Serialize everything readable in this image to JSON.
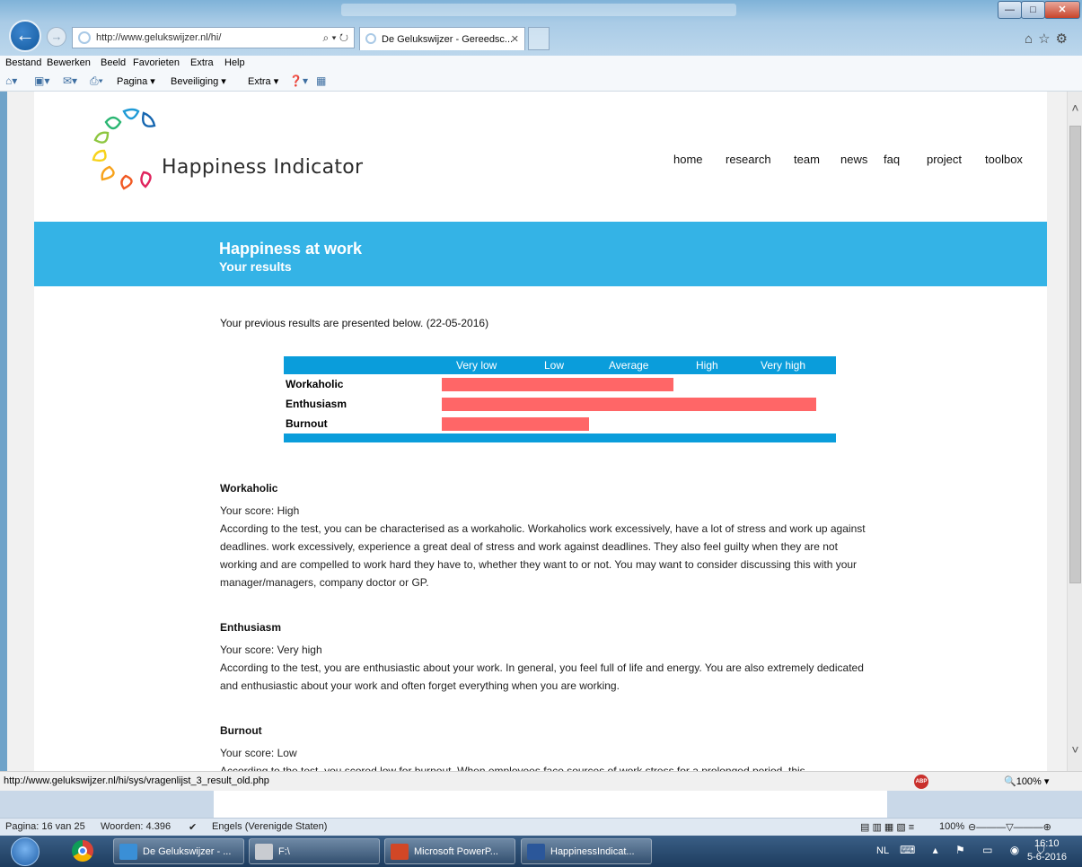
{
  "browser": {
    "url": "http://www.gelukswijzer.nl/hi/",
    "addr_actions": "⌕ ▾ ↻",
    "tab_title": "De Gelukswijzer - Gereedsc...",
    "tab_close": "✕",
    "window_buttons": {
      "minimize": "—",
      "maximize": "□",
      "close": "✕"
    },
    "menu": [
      "Bestand",
      "Bewerken",
      "Beeld",
      "Favorieten",
      "Extra",
      "Help"
    ],
    "commands": {
      "pagina": "Pagina ▾",
      "beveiliging": "Beveiliging ▾",
      "extra": "Extra ▾"
    },
    "status_url": "http://www.gelukswijzer.nl/hi/sys/vragenlijst_3_result_old.php",
    "abp": "ABP",
    "zoom": "🔍100%  ▾"
  },
  "site": {
    "logo_text": "Happiness Indicator",
    "nav": [
      "home",
      "research",
      "team",
      "news",
      "faq",
      "project",
      "toolbox"
    ],
    "banner_title": "Happiness at work",
    "banner_subtitle": "Your results",
    "intro": "Your previous results are presented below. (22-05-2016)"
  },
  "results": {
    "levels": [
      "Very low",
      "Low",
      "Average",
      "High",
      "Very high"
    ],
    "rows": [
      {
        "label": "Workaholic",
        "score": "High",
        "level": 0.59
      },
      {
        "label": "Enthusiasm",
        "score": "Very high",
        "level": 0.955
      },
      {
        "label": "Burnout",
        "score": "Low",
        "level": 0.375
      }
    ]
  },
  "sections": [
    {
      "title": "Workaholic",
      "score": "Your score: High",
      "body": "According to the test, you can be characterised as a workaholic. Workaholics work excessively, have a lot of stress and work up against deadlines. work excessively, experience a great deal of stress and work against deadlines. They also feel guilty when they are not working and are compelled to work hard  they have to, whether they want to or not. You may want to consider discussing this with your manager/managers, company doctor or GP."
    },
    {
      "title": "Enthusiasm",
      "score": "Your score: Very high",
      "body": "According to the test, you are enthusiastic about your work. In general, you feel full of life and energy. You are also extremely dedicated and enthusiastic about your work and often forget everything when you are working."
    },
    {
      "title": "Burnout",
      "score": "Your score: Low",
      "body": "According to the test, you scored low for burnout. When employees face sources of work stress for a prolonged period, this"
    }
  ],
  "word_status": {
    "page": "Pagina: 16 van 25",
    "words": "Woorden: 4.396",
    "language": "Engels (Verenigde Staten)",
    "zoom": "100%"
  },
  "taskbar": {
    "items": [
      "De Gelukswijzer - ...",
      "F:\\",
      "Microsoft PowerP...",
      "HappinessIndicat..."
    ],
    "lang": "NL",
    "time": "16:10",
    "date": "5-6-2016"
  },
  "colors": {
    "banner": "#34b3e6",
    "chart_blue": "#0a9ddb",
    "bar": "#ff6667"
  }
}
